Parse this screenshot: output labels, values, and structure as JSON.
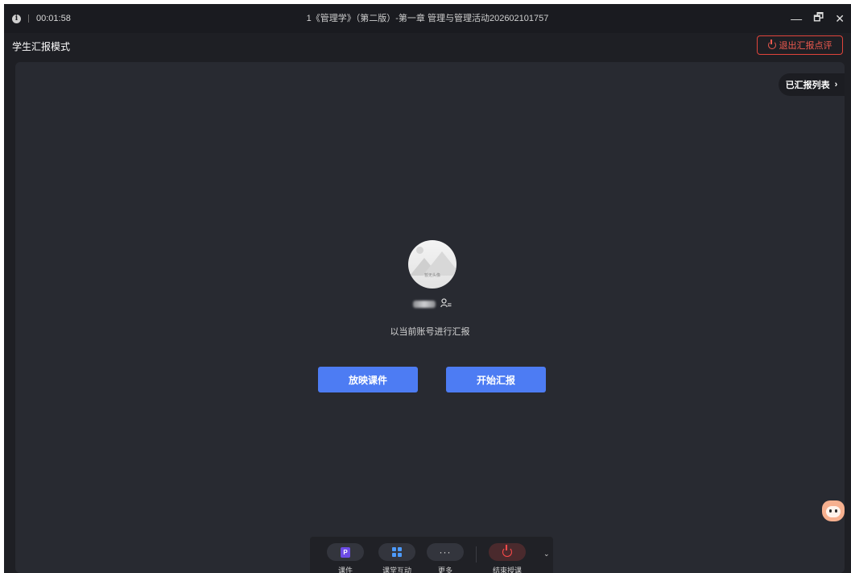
{
  "titlebar": {
    "timer": "00:01:58",
    "title": "1《管理学》（第二版）-第一章 管理与管理活动202602101757",
    "min": "—",
    "restore": "🗗",
    "close": "✕"
  },
  "header": {
    "mode_title": "学生汇报模式",
    "exit_label": "退出汇报点评"
  },
  "stage": {
    "reported_list": "已汇报列表",
    "reported_chevron": "›",
    "avatar_caption": "暂无头像",
    "account_hint": "以当前账号进行汇报",
    "play_courseware": "放映课件",
    "start_report": "开始汇报"
  },
  "toolbar": {
    "items": [
      {
        "label": "课件"
      },
      {
        "label": "课堂互动"
      },
      {
        "label": "更多"
      },
      {
        "label": "结束授课"
      }
    ],
    "p_letter": "P",
    "dots": "···",
    "collapse": "⌄"
  },
  "colors": {
    "accent": "#4d7cf3",
    "danger": "#e0443b",
    "stage_bg": "#282a31"
  }
}
